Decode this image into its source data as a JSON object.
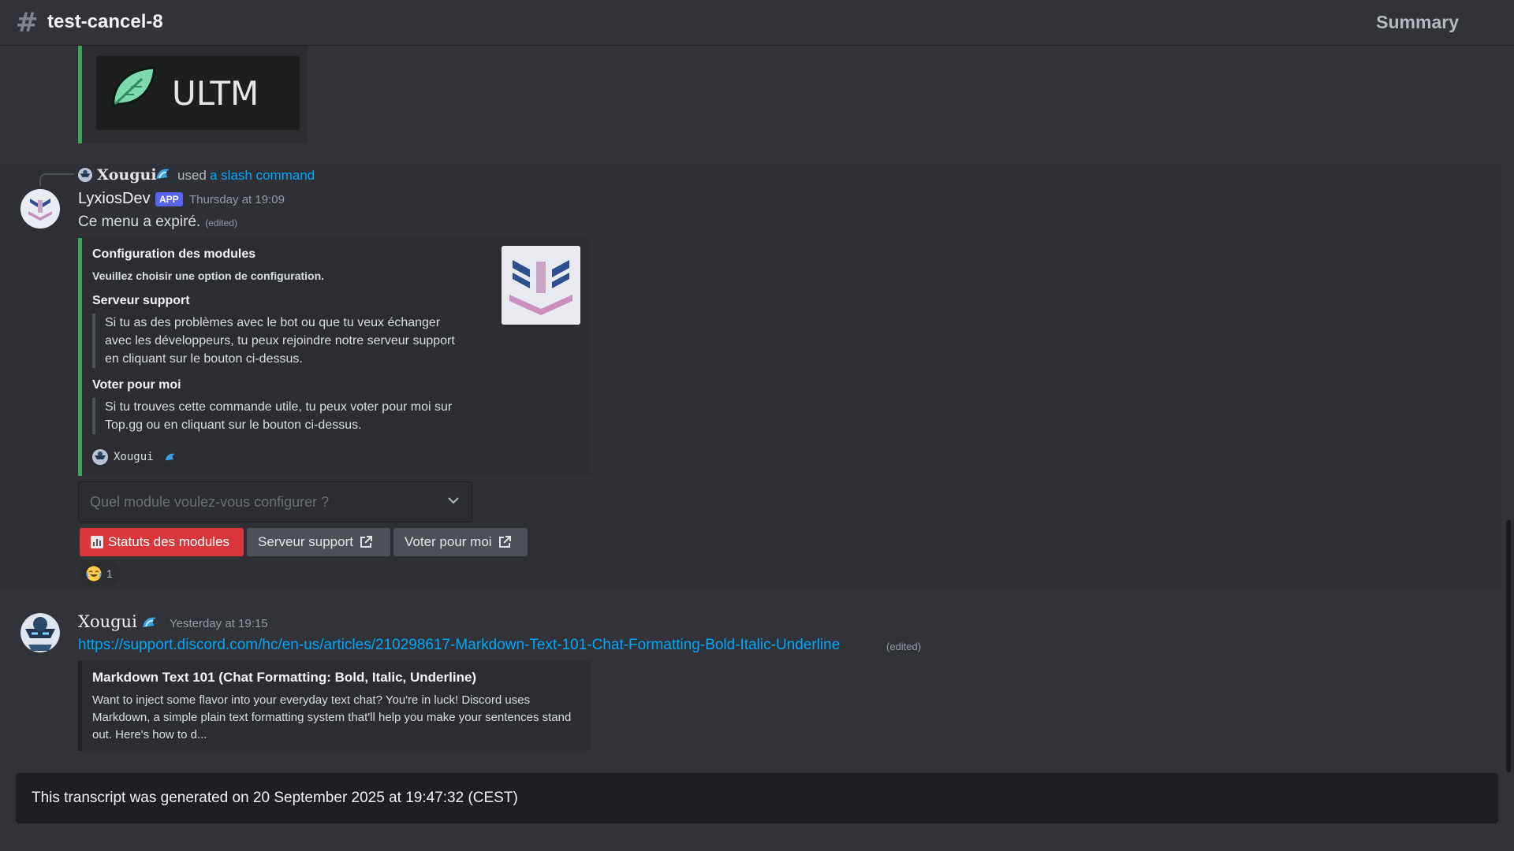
{
  "header": {
    "channel_name": "test-cancel-8",
    "summary_label": "Summary"
  },
  "top_embed": {
    "image_text": "ULTM",
    "accent_color": "#3ba55c"
  },
  "reply": {
    "user": "Xougui",
    "used_text": "used",
    "command_link": "a slash command"
  },
  "message1": {
    "author": "LyxiosDev",
    "badge": "APP",
    "timestamp": "Thursday at 19:09",
    "content": "Ce menu a expiré.",
    "edited": "(edited)",
    "embed": {
      "title": "Configuration des modules",
      "description": "Veuillez choisir une option de configuration.",
      "fields": [
        {
          "name": "Serveur support",
          "lines": [
            "Si tu as des problèmes avec le bot ou que tu veux échanger",
            "avec les développeurs, tu peux rejoindre notre serveur support",
            "en cliquant sur le bouton ci-dessus."
          ]
        },
        {
          "name": "Voter pour moi",
          "lines": [
            "Si tu trouves cette commande utile, tu peux voter pour moi sur",
            "Top.gg ou en cliquant sur le bouton ci-dessus."
          ]
        }
      ],
      "footer": "Xougui"
    },
    "select_placeholder": "Quel module voulez-vous configurer ?",
    "buttons": [
      {
        "label": "Statuts des modules",
        "icon": "bar-chart-icon",
        "color": "#da373c"
      },
      {
        "label": "Serveur support",
        "icon": "external-link-icon",
        "color": "#4e5058"
      },
      {
        "label": "Voter pour moi",
        "icon": "external-link-icon",
        "color": "#4e5058"
      }
    ],
    "reaction": {
      "emoji": "joy-emoji",
      "count": "1"
    }
  },
  "message2": {
    "author": "Xougui",
    "timestamp": "Yesterday at 19:15",
    "link": "https://support.discord.com/hc/en-us/articles/210298617-Markdown-Text-101-Chat-Formatting-Bold-Italic-Underline",
    "edited": "(edited)",
    "embed": {
      "title": "Markdown Text 101 (Chat Formatting: Bold, Italic, Underline)",
      "description": "Want to inject some flavor into your everyday text chat? You're in luck! Discord uses Markdown, a simple plain text formatting system that'll help you make your sentences stand out. Here's how to d..."
    }
  },
  "footer": {
    "text": "This transcript was generated on 20 September 2025 at 19:47:32 (CEST)"
  }
}
